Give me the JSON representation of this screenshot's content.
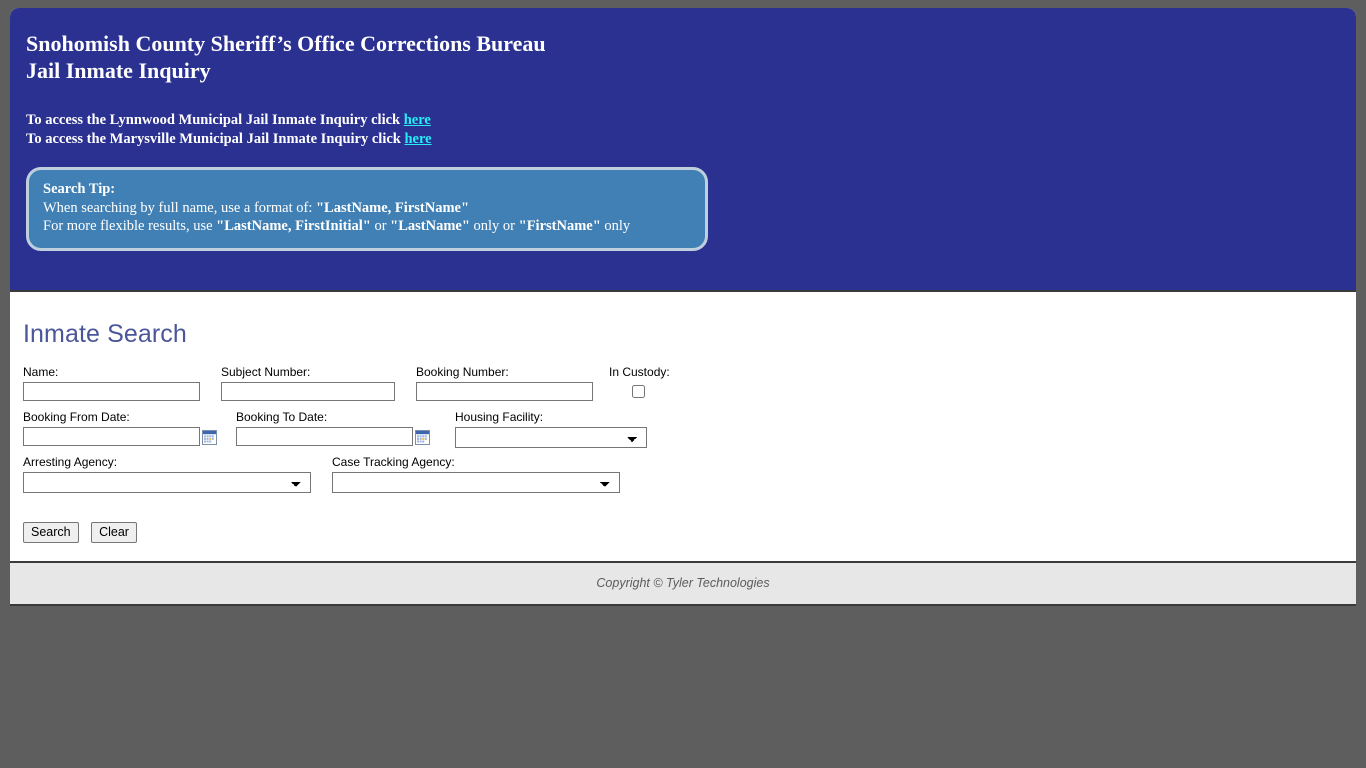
{
  "header": {
    "title_line1": "Snohomish County Sheriff’s Office Corrections Bureau",
    "title_line2": "Jail Inmate Inquiry",
    "access_lynnwood_text": "To access the Lynnwood Municipal Jail Inmate Inquiry click ",
    "access_lynnwood_link": "here",
    "access_marysville_text": "To access the Marysville Municipal Jail Inmate Inquiry click ",
    "access_marysville_link": "here",
    "background_color": "#2b3191",
    "link_color": "#26ecf5"
  },
  "tip": {
    "title": "Search Tip:",
    "line1_a": "When searching by full name, use a format of: ",
    "line1_b": "\"LastName, FirstName\"",
    "line2_a": "For more flexible results, use ",
    "line2_b": "\"LastName, FirstInitial\"",
    "line2_c": " or ",
    "line2_d": "\"LastName\"",
    "line2_e": " only or ",
    "line2_f": "\"FirstName\"",
    "line2_g": " only",
    "background_color": "#4180b4",
    "border_color": "#bfcfdd"
  },
  "main": {
    "heading": "Inmate Search",
    "heading_color": "#4a5699",
    "fields": {
      "name": {
        "label": "Name:",
        "value": "",
        "placeholder": ""
      },
      "subject_number": {
        "label": "Subject Number:",
        "value": "",
        "placeholder": ""
      },
      "booking_number": {
        "label": "Booking Number:",
        "value": "",
        "placeholder": ""
      },
      "in_custody": {
        "label": "In Custody:",
        "checked": false
      },
      "booking_from_date": {
        "label": "Booking From Date:",
        "value": "",
        "placeholder": ""
      },
      "booking_to_date": {
        "label": "Booking To Date:",
        "value": "",
        "placeholder": ""
      },
      "housing_facility": {
        "label": "Housing Facility:",
        "selected": "",
        "options": [
          ""
        ]
      },
      "arresting_agency": {
        "label": "Arresting Agency:",
        "selected": "",
        "options": [
          ""
        ]
      },
      "case_tracking_agency": {
        "label": "Case Tracking Agency:",
        "selected": "",
        "options": [
          ""
        ]
      }
    },
    "buttons": {
      "search": "Search",
      "clear": "Clear"
    },
    "icons": {
      "calendar": "calendar-icon",
      "dropdown": "chevron-down-icon"
    }
  },
  "footer": {
    "copyright": "Copyright © Tyler Technologies"
  }
}
